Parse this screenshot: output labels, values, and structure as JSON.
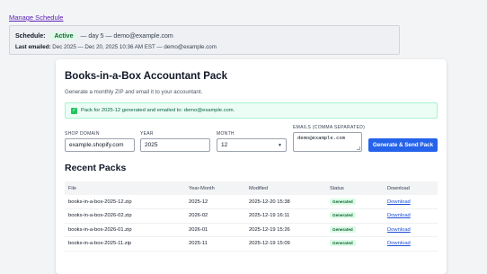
{
  "manage_link": "Manage Schedule",
  "schedule": {
    "label": "Schedule:",
    "status": "Active",
    "detail": "— day 5 — demo@example.com",
    "last_emailed_label": "Last emailed:",
    "last_emailed_value": "Dec 2025 — Dec 20, 2025 10:36 AM EST — demo@example.com"
  },
  "card": {
    "title": "Books-in-a-Box Accountant Pack",
    "subtitle": "Generate a monthly ZIP and email it to your accountant.",
    "alert": "Pack for 2025-12 generated and emailed to: demo@example.com."
  },
  "form": {
    "shop_label": "SHOP DOMAIN",
    "shop_value": "example.shopify.com",
    "year_label": "YEAR",
    "year_value": "2025",
    "month_label": "MONTH",
    "month_value": "12",
    "emails_label": "EMAILS (COMMA SEPARATED)",
    "emails_value": "demo@example.com",
    "submit_label": "Generate & Send Pack"
  },
  "recent": {
    "title": "Recent Packs",
    "columns": [
      "File",
      "Year-Month",
      "Modified",
      "Status",
      "Download"
    ],
    "rows": [
      {
        "file": "books-in-a-box-2025-12.zip",
        "ym": "2025-12",
        "modified": "2025-12-20 15:38",
        "status": "Generated",
        "download": "Download"
      },
      {
        "file": "books-in-a-box-2026-02.zip",
        "ym": "2026-02",
        "modified": "2025-12-19 16:11",
        "status": "Generated",
        "download": "Download"
      },
      {
        "file": "books-in-a-box-2026-01.zip",
        "ym": "2026-01",
        "modified": "2025-12-19 15:26",
        "status": "Generated",
        "download": "Download"
      },
      {
        "file": "books-in-a-box-2025-11.zip",
        "ym": "2025-11",
        "modified": "2025-12-19 15:09",
        "status": "Generated",
        "download": "Download"
      }
    ]
  },
  "colors": {
    "accent": "#2563eb",
    "success_bg": "#dcfce7",
    "success_text": "#166534"
  }
}
